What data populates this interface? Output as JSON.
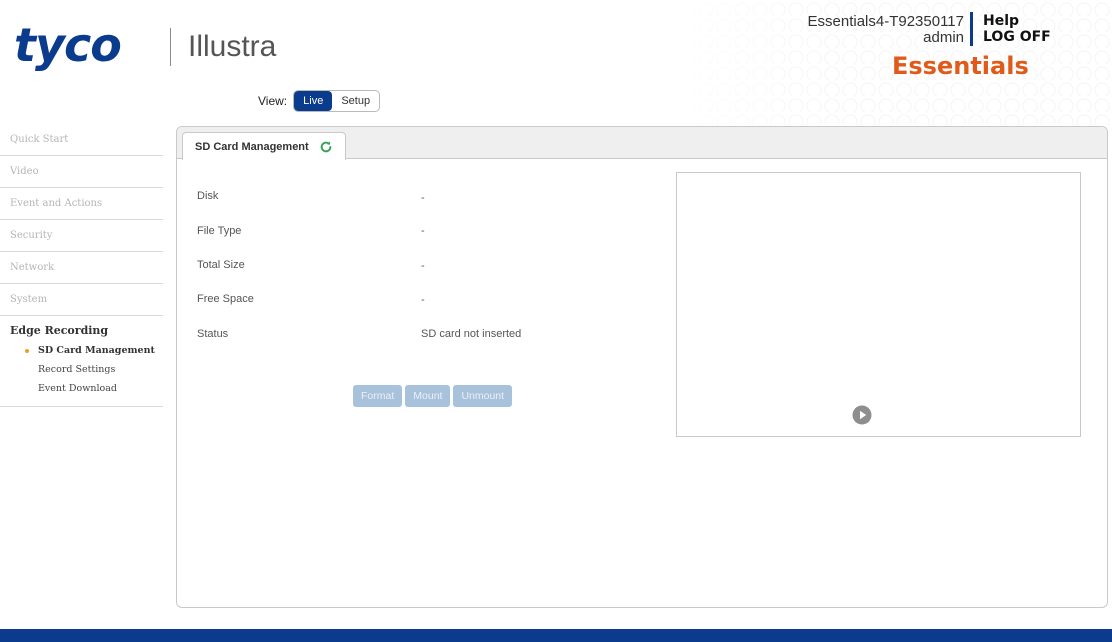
{
  "header": {
    "logo_main": "tyco",
    "logo_sub": "Illustra",
    "device_name": "Essentials4-T92350117",
    "user": "admin",
    "help_label": "Help",
    "logoff_label": "LOG OFF",
    "brand": "Essentials"
  },
  "view": {
    "label": "View:",
    "live_label": "Live",
    "setup_label": "Setup",
    "selected": "Live"
  },
  "sidebar": {
    "items": [
      {
        "label": "Quick Start"
      },
      {
        "label": "Video"
      },
      {
        "label": "Event and Actions"
      },
      {
        "label": "Security"
      },
      {
        "label": "Network"
      },
      {
        "label": "System"
      }
    ],
    "group": {
      "title": "Edge Recording",
      "subs": [
        {
          "label": "SD Card Management"
        },
        {
          "label": "Record Settings"
        },
        {
          "label": "Event Download"
        }
      ]
    }
  },
  "main": {
    "tab_label": "SD Card Management",
    "fields": [
      {
        "label": "Disk",
        "value": "-"
      },
      {
        "label": "File Type",
        "value": "-"
      },
      {
        "label": "Total Size",
        "value": "-"
      },
      {
        "label": "Free Space",
        "value": "-"
      },
      {
        "label": "Status",
        "value": "SD card not inserted"
      }
    ],
    "buttons": {
      "format": "Format",
      "mount": "Mount",
      "unmount": "Unmount"
    }
  },
  "colors": {
    "brand_blue": "#0b3b8c",
    "brand_orange": "#e05a1a",
    "disabled_button": "#a9c2dc"
  },
  "icons": {
    "refresh": "refresh-icon",
    "play": "play-icon"
  }
}
